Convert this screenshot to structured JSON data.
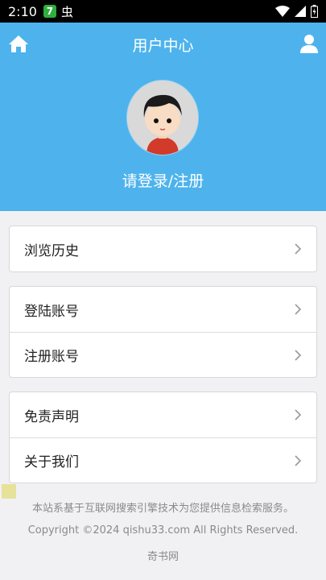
{
  "status_bar": {
    "time": "2:10",
    "app_badge": "7"
  },
  "header": {
    "title": "用户中心",
    "login_text": "请登录/注册"
  },
  "menu": {
    "group1": [
      {
        "label": "浏览历史"
      }
    ],
    "group2": [
      {
        "label": "登陆账号"
      },
      {
        "label": "注册账号"
      }
    ],
    "group3": [
      {
        "label": "免责声明"
      },
      {
        "label": "关于我们"
      }
    ]
  },
  "footer": {
    "notice": "本站系基于互联网搜索引擎技术为您提供信息检索服务。",
    "copyright": "Copyright ©2024 qishu33.com All Rights Reserved.",
    "site_name": "奇书网"
  },
  "colors": {
    "header_bg": "#4eb3ec",
    "page_bg": "#f1f1f3"
  },
  "icons": [
    "home-icon",
    "user-icon",
    "chevron-right-icon",
    "wifi-icon",
    "signal-icon",
    "battery-icon"
  ]
}
